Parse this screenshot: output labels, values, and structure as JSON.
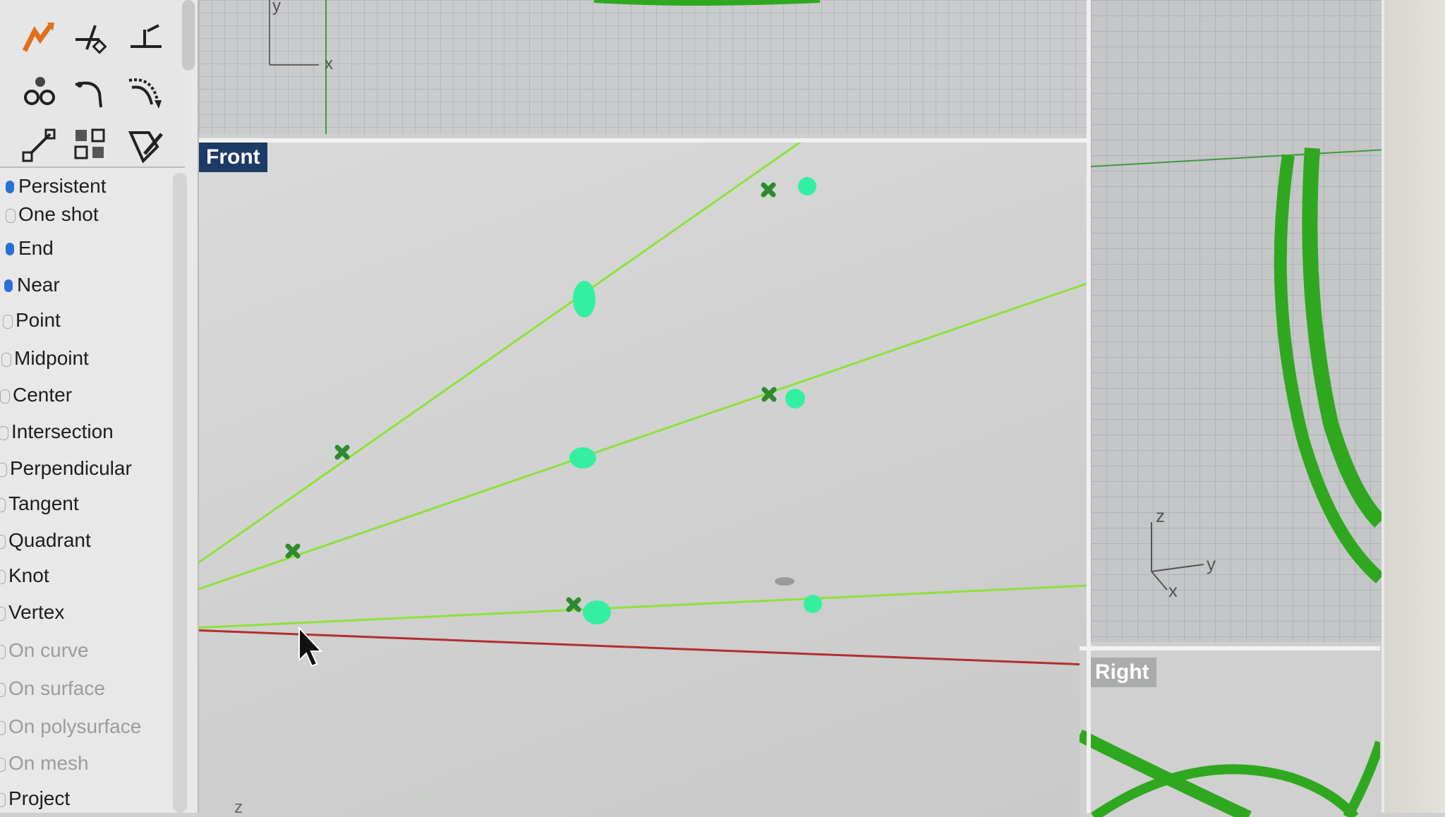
{
  "toolbar": {
    "tools": [
      {
        "name": "extend-tool-icon"
      },
      {
        "name": "trim-tool-icon"
      },
      {
        "name": "split-tool-icon"
      },
      {
        "name": "points-tool-icon"
      },
      {
        "name": "fillet-tool-icon"
      },
      {
        "name": "offset-curve-tool-icon"
      },
      {
        "name": "scale-tool-icon"
      },
      {
        "name": "array-tool-icon"
      },
      {
        "name": "edit-tool-icon"
      }
    ]
  },
  "osnap": {
    "items": [
      {
        "label": "Persistent",
        "enabled": true,
        "checked": true
      },
      {
        "label": "One shot",
        "enabled": true,
        "checked": false
      },
      {
        "label": "End",
        "enabled": true,
        "checked": true
      },
      {
        "label": "Near",
        "enabled": true,
        "checked": true
      },
      {
        "label": "Point",
        "enabled": true,
        "checked": false
      },
      {
        "label": "Midpoint",
        "enabled": true,
        "checked": false
      },
      {
        "label": "Center",
        "enabled": true,
        "checked": false
      },
      {
        "label": "Intersection",
        "enabled": true,
        "checked": false
      },
      {
        "label": "Perpendicular",
        "enabled": true,
        "checked": false
      },
      {
        "label": "Tangent",
        "enabled": true,
        "checked": false
      },
      {
        "label": "Quadrant",
        "enabled": true,
        "checked": false
      },
      {
        "label": "Knot",
        "enabled": true,
        "checked": false
      },
      {
        "label": "Vertex",
        "enabled": true,
        "checked": false
      },
      {
        "label": "On curve",
        "enabled": false,
        "checked": false
      },
      {
        "label": "On surface",
        "enabled": false,
        "checked": false
      },
      {
        "label": "On polysurface",
        "enabled": false,
        "checked": false
      },
      {
        "label": "On mesh",
        "enabled": false,
        "checked": false
      },
      {
        "label": "Project",
        "enabled": true,
        "checked": false
      }
    ]
  },
  "viewports": {
    "top": {
      "axis_y": "y",
      "axis_x": "x"
    },
    "front": {
      "label": "Front",
      "axis_z": "z"
    },
    "perspective": {
      "axis_z": "z",
      "axis_y": "y",
      "axis_x": "x"
    },
    "right": {
      "label": "Right"
    }
  },
  "colors": {
    "curve": "#8ee13a",
    "control_point": "#2f8a2f",
    "selected_point": "#33f0a0",
    "x_axis": "#b03030",
    "label_active_bg": "#1e3a66",
    "geometry_green": "#2fa81f"
  }
}
